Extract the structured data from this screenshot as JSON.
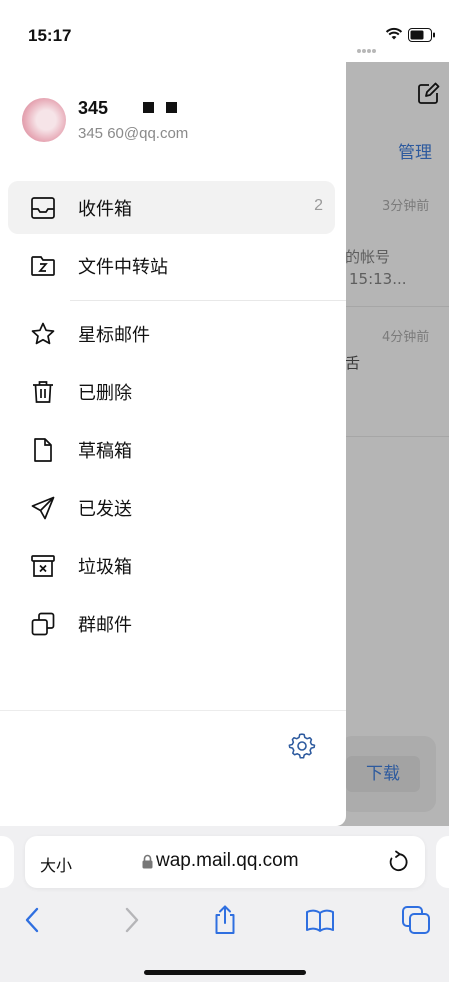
{
  "status_bar": {
    "time": "15:17"
  },
  "background_page": {
    "manage_label": "管理",
    "mail_1": {
      "time": "3分钟前",
      "line1": "的帐号",
      "line2": "15:13..."
    },
    "mail_2": {
      "time": "4分钟前",
      "line1": "舌"
    },
    "download_label": "下载"
  },
  "drawer": {
    "user": {
      "name": "345",
      "email": "345        60@qq.com"
    },
    "folders": [
      {
        "label": "收件箱",
        "count": "2",
        "icon": "inbox-icon"
      },
      {
        "label": "文件中转站",
        "icon": "file-transfer-icon"
      },
      {
        "label": "星标邮件",
        "icon": "star-icon"
      },
      {
        "label": "已删除",
        "icon": "trash-icon"
      },
      {
        "label": "草稿箱",
        "icon": "draft-icon"
      },
      {
        "label": "已发送",
        "icon": "send-icon"
      },
      {
        "label": "垃圾箱",
        "icon": "spam-icon"
      },
      {
        "label": "群邮件",
        "icon": "group-mail-icon"
      }
    ]
  },
  "browser": {
    "text_size_label": "大小",
    "url": "wap.mail.qq.com"
  },
  "colors": {
    "accent": "#2d5a9e",
    "active_row": "#f2f2f2",
    "dim_overlay": "#b5b5b5"
  }
}
